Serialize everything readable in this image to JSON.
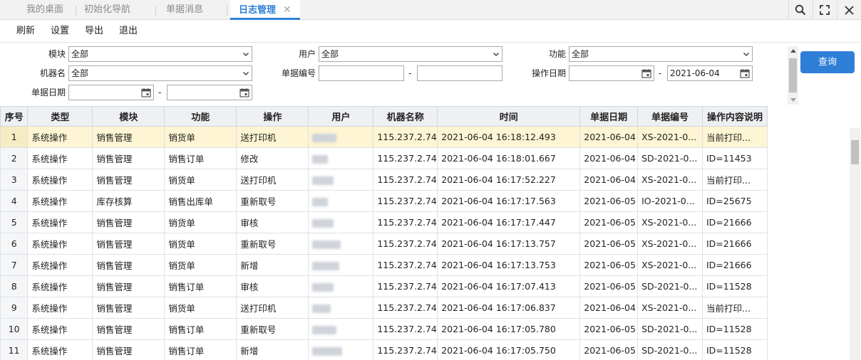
{
  "tabs": [
    {
      "label": "我的桌面",
      "active": false
    },
    {
      "label": "初始化导航",
      "active": false
    },
    {
      "label": "单据消息",
      "active": false
    },
    {
      "label": "日志管理",
      "active": true
    }
  ],
  "tab_close_glyph": "✕",
  "menu": {
    "refresh": "刷新",
    "settings": "设置",
    "export": "导出",
    "exit": "退出"
  },
  "filters": {
    "module_label": "模块",
    "module_value": "全部",
    "user_label": "用户",
    "user_value": "全部",
    "function_label": "功能",
    "function_value": "全部",
    "machine_label": "机器名",
    "machine_value": "全部",
    "docno_label": "单据编号",
    "docno_from": "",
    "docno_to": "",
    "opdate_label": "操作日期",
    "opdate_from": "",
    "opdate_to": "2021-06-04",
    "docdate_label": "单据日期",
    "docdate_from": "",
    "docdate_to": "",
    "range_sep": "-"
  },
  "query_button": "查询",
  "colors": {
    "accent": "#2f7fd8",
    "selected_row": "#fdf5d3",
    "header_bg": "#eef0f3"
  },
  "grid": {
    "columns": [
      "序号",
      "类型",
      "模块",
      "功能",
      "操作",
      "用户",
      "机器名称",
      "时间",
      "单据日期",
      "单据编号",
      "操作内容说明"
    ],
    "rows": [
      [
        "1",
        "系统操作",
        "销售管理",
        "销货单",
        "送打印机",
        "",
        "115.237.2.74",
        "2021-06-04 16:18:12.493",
        "2021-06-04",
        "XS-2021-0...",
        "当前打印..."
      ],
      [
        "2",
        "系统操作",
        "销售管理",
        "销售订单",
        "修改",
        "",
        "115.237.2.74",
        "2021-06-04 16:18:01.667",
        "2021-06-04",
        "SD-2021-0...",
        "ID=11453"
      ],
      [
        "3",
        "系统操作",
        "销售管理",
        "销货单",
        "送打印机",
        "",
        "115.237.2.74",
        "2021-06-04 16:17:52.227",
        "2021-06-04",
        "XS-2021-0...",
        "当前打印..."
      ],
      [
        "4",
        "系统操作",
        "库存核算",
        "销售出库单",
        "重新取号",
        "",
        "115.237.2.74",
        "2021-06-04 16:17:17.563",
        "2021-06-05",
        "IO-2021-0...",
        "ID=25675"
      ],
      [
        "5",
        "系统操作",
        "销售管理",
        "销货单",
        "审核",
        "",
        "115.237.2.74",
        "2021-06-04 16:17:17.447",
        "2021-06-05",
        "XS-2021-0...",
        "ID=21666"
      ],
      [
        "6",
        "系统操作",
        "销售管理",
        "销货单",
        "重新取号",
        "",
        "115.237.2.74",
        "2021-06-04 16:17:13.757",
        "2021-06-05",
        "XS-2021-0...",
        "ID=21666"
      ],
      [
        "7",
        "系统操作",
        "销售管理",
        "销货单",
        "新增",
        "",
        "115.237.2.74",
        "2021-06-04 16:17:13.753",
        "2021-06-05",
        "XS-2021-0...",
        "ID=21666"
      ],
      [
        "8",
        "系统操作",
        "销售管理",
        "销售订单",
        "审核",
        "",
        "115.237.2.74",
        "2021-06-04 16:17:07.413",
        "2021-06-05",
        "SD-2021-0...",
        "ID=11528"
      ],
      [
        "9",
        "系统操作",
        "销售管理",
        "销货单",
        "送打印机",
        "",
        "115.237.2.74",
        "2021-06-04 16:17:06.837",
        "2021-06-04",
        "XS-2021-0...",
        "当前打印..."
      ],
      [
        "10",
        "系统操作",
        "销售管理",
        "销售订单",
        "重新取号",
        "",
        "115.237.2.74",
        "2021-06-04 16:17:05.780",
        "2021-06-05",
        "SD-2021-0...",
        "ID=11528"
      ],
      [
        "11",
        "系统操作",
        "销售管理",
        "销售订单",
        "新增",
        "",
        "115.237.2.74",
        "2021-06-04 16:17:05.750",
        "2021-06-05",
        "SD-2021-0...",
        "ID=11528"
      ]
    ]
  }
}
